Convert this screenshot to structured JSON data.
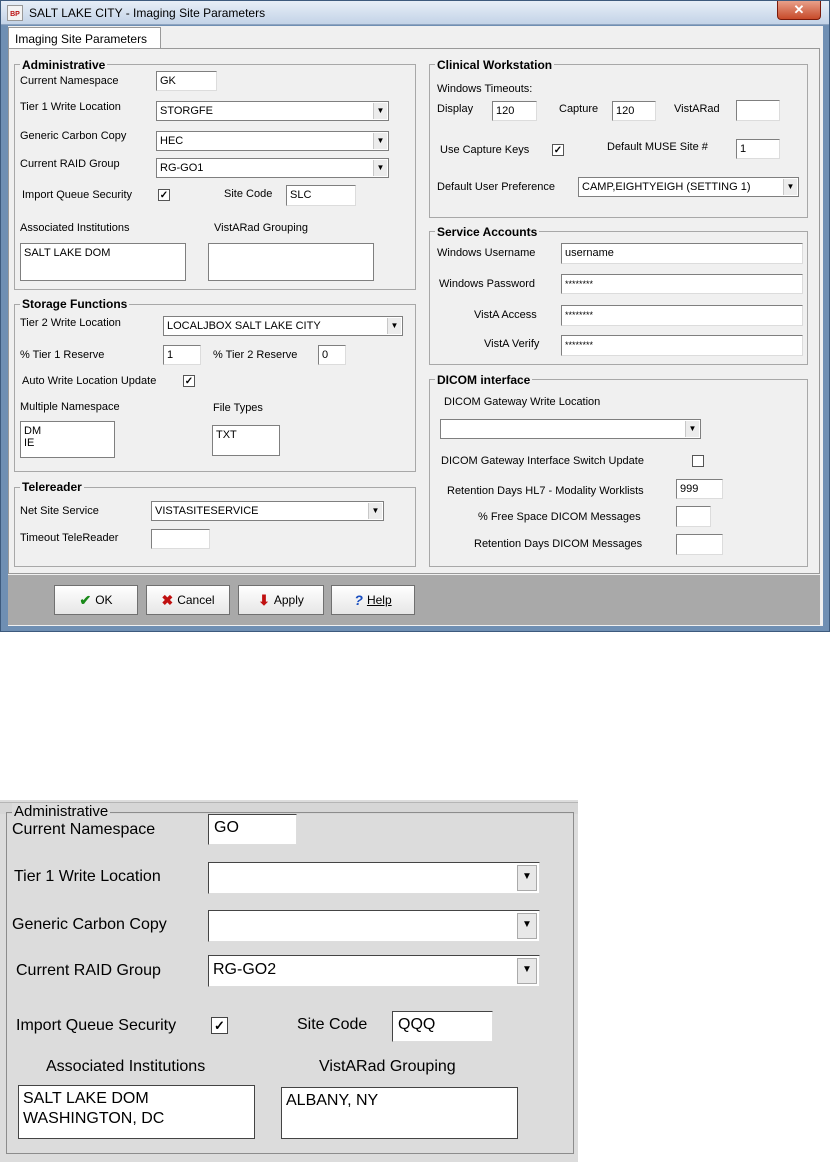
{
  "window": {
    "title": "SALT LAKE CITY - Imaging Site Parameters",
    "icon_text": "BP",
    "close_glyph": "✕",
    "tab_label": "Imaging Site Parameters"
  },
  "administrative": {
    "title": "Administrative",
    "current_namespace_label": "Current Namespace",
    "current_namespace_value": "GK",
    "tier1_label": "Tier 1 Write Location",
    "tier1_value": "STORGFE",
    "generic_cc_label": "Generic Carbon Copy",
    "generic_cc_value": "HEC",
    "raid_label": "Current RAID Group",
    "raid_value": "RG-GO1",
    "import_queue_label": "Import Queue Security",
    "import_queue_checked": "✓",
    "site_code_label": "Site Code",
    "site_code_value": "SLC",
    "assoc_label": "Associated Institutions",
    "assoc_value": "SALT LAKE DOM",
    "vistarad_label": "VistARad Grouping",
    "vistarad_value": ""
  },
  "storage": {
    "title": "Storage Functions",
    "tier2_label": "Tier 2 Write Location",
    "tier2_value": "LOCALJBOX   SALT LAKE CITY",
    "tier1_reserve_label": "% Tier 1 Reserve",
    "tier1_reserve_value": "1",
    "tier2_reserve_label": "% Tier 2 Reserve",
    "tier2_reserve_value": "0",
    "auto_write_label": "Auto Write Location Update",
    "auto_write_checked": "✓",
    "multi_ns_label": "Multiple Namespace",
    "multi_ns_value": "DM\nIE",
    "file_types_label": "File Types",
    "file_types_value": "TXT"
  },
  "telereader": {
    "title": "Telereader",
    "net_site_label": "Net Site Service",
    "net_site_value": "VISTASITESERVICE",
    "timeout_label": "Timeout TeleReader",
    "timeout_value": ""
  },
  "clinical": {
    "title": "Clinical Workstation",
    "timeouts_label": "Windows Timeouts:",
    "display_label": "Display",
    "display_value": "120",
    "capture_label": "Capture",
    "capture_value": "120",
    "vistarad_label": "VistARad",
    "vistarad_value": "",
    "use_capture_label": "Use Capture Keys",
    "use_capture_checked": "✓",
    "muse_label": "Default MUSE Site #",
    "muse_value": "1",
    "user_pref_label": "Default User Preference",
    "user_pref_value": "CAMP,EIGHTYEIGH (SETTING 1)"
  },
  "service": {
    "title": "Service Accounts",
    "win_user_label": "Windows Username",
    "win_user_value": "username",
    "win_pass_label": "Windows Password",
    "win_pass_value": "********",
    "access_label": "VistA Access",
    "access_value": "********",
    "verify_label": "VistA Verify",
    "verify_value": "********"
  },
  "dicom": {
    "title": "DICOM interface",
    "gateway_label": "DICOM Gateway Write Location",
    "gateway_value": "",
    "switch_label": "DICOM Gateway  Interface Switch Update",
    "switch_checked": "",
    "hl7_label": "Retention Days HL7 - Modality Worklists",
    "hl7_value": "999",
    "free_space_label": "% Free Space DICOM Messages",
    "free_space_value": "",
    "retention_label": "Retention Days DICOM Messages",
    "retention_value": ""
  },
  "buttons": {
    "ok": "OK",
    "cancel": "Cancel",
    "apply": "Apply",
    "help": "Help"
  },
  "zoom": {
    "title": "Administrative",
    "current_namespace_label": "Current Namespace",
    "current_namespace_value": "GO",
    "tier1_label": "Tier 1 Write Location",
    "tier1_value": "",
    "generic_cc_label": "Generic Carbon Copy",
    "generic_cc_value": "",
    "raid_label": "Current RAID Group",
    "raid_value": "RG-GO2",
    "import_queue_label": "Import Queue Security",
    "import_queue_checked": "✓",
    "site_code_label": "Site Code",
    "site_code_value": "QQQ",
    "assoc_label": "Associated Institutions",
    "assoc_value": "SALT LAKE DOM\nWASHINGTON, DC",
    "vistarad_label": "VistARad Grouping",
    "vistarad_value": "ALBANY, NY"
  },
  "colors": {
    "window_frame": "#6f8fb3",
    "dialog_bg": "#f0f0f0",
    "button_bar": "#a9a9a9",
    "ok_check": "#1a8a1a",
    "cancel_x": "#c01010",
    "apply_arrow": "#c01010",
    "help_mark": "#1a4fc0"
  }
}
